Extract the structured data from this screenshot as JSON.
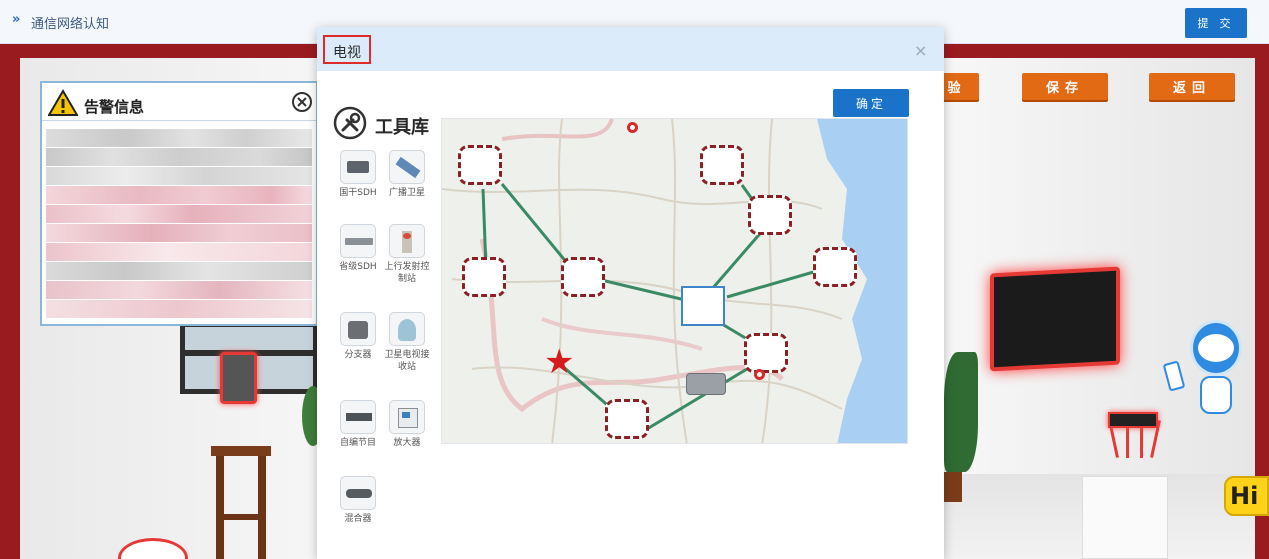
{
  "header": {
    "arrow": "»",
    "breadcrumb": "通信网络认知",
    "submit_label": "提 交"
  },
  "scene": {
    "buttons": [
      {
        "label": "验"
      },
      {
        "label": "保存"
      },
      {
        "label": "返回"
      }
    ],
    "hi_label": "Hi"
  },
  "alert": {
    "title": "告警信息",
    "content_redacted": true
  },
  "modal": {
    "title": "电视",
    "close_glyph": "×",
    "confirm_label": "确定",
    "toolbox_title": "工具库",
    "tools": [
      {
        "label": "国干SDH",
        "icon": "sdh-device-icon"
      },
      {
        "label": "广播卫星",
        "icon": "satellite-icon"
      },
      {
        "label": "省级SDH",
        "icon": "sdh-rack-icon"
      },
      {
        "label": "上行发射控制站",
        "icon": "uplink-station-icon"
      },
      {
        "label": "分支器",
        "icon": "splitter-icon"
      },
      {
        "label": "卫星电视接收站",
        "icon": "receiver-station-icon"
      },
      {
        "label": "自编节目",
        "icon": "program-box-icon"
      },
      {
        "label": "放大器",
        "icon": "amplifier-icon"
      },
      {
        "label": "混合器",
        "icon": "mixer-icon"
      }
    ]
  },
  "colors": {
    "accent_blue": "#1a73c9",
    "orange": "#e26a14",
    "alert_red": "#e02b2b",
    "node_border": "#8b1f24",
    "link_green": "#3a8a63"
  }
}
